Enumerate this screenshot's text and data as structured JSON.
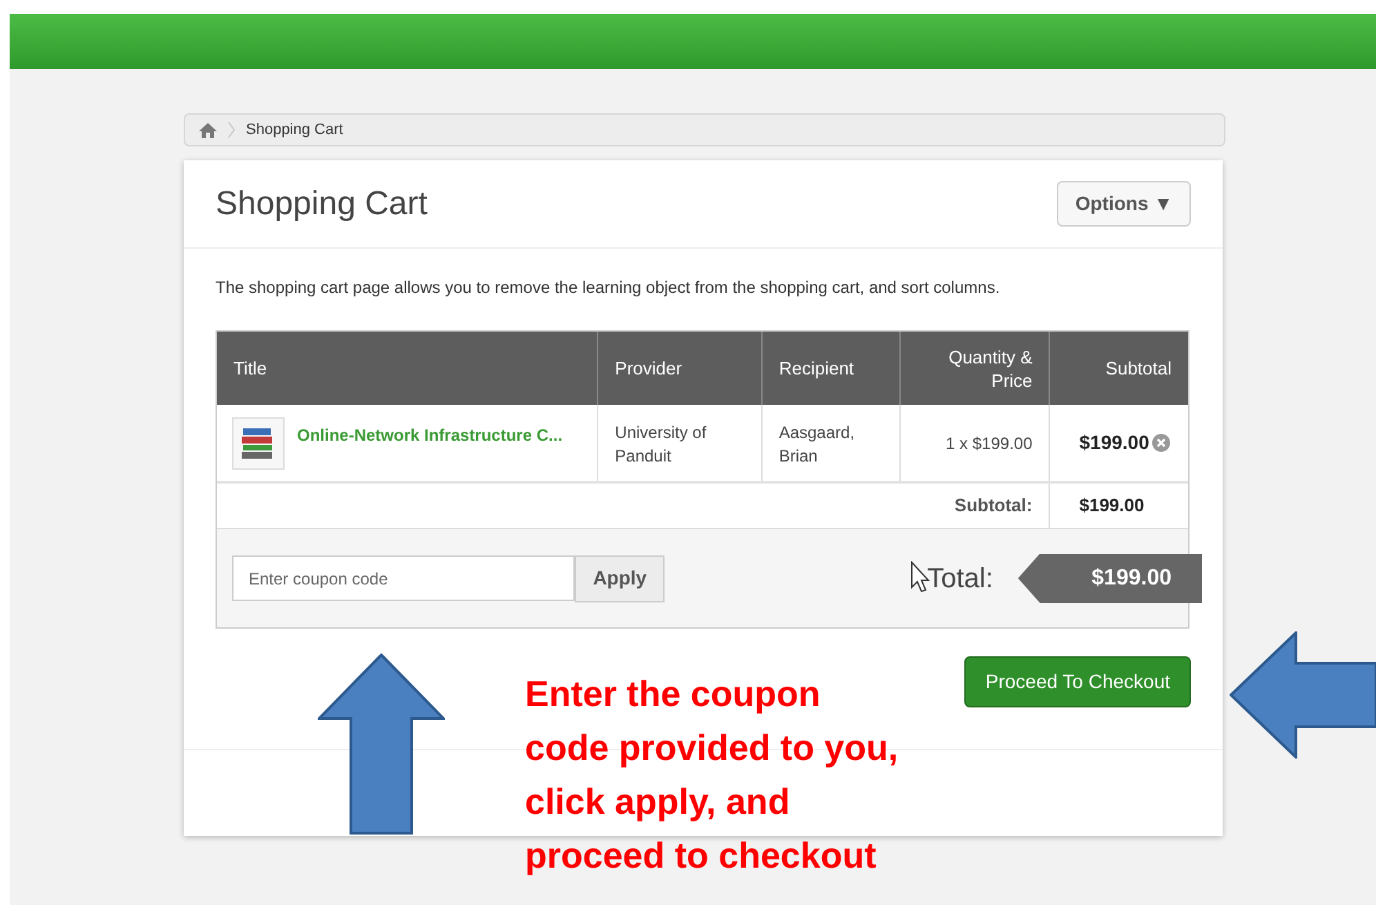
{
  "breadcrumb": {
    "items": [
      "Shopping Cart"
    ]
  },
  "page": {
    "title": "Shopping Cart",
    "options_button": "Options ▼",
    "description": "The shopping cart page allows you to remove the learning object from the shopping cart, and sort columns."
  },
  "table": {
    "columns": [
      "Title",
      "Provider",
      "Recipient",
      "Quantity & Price",
      "Subtotal"
    ],
    "rows": [
      {
        "title": "Online-Network Infrastructure C...",
        "provider": "University of Panduit",
        "recipient": "Aasgaard, Brian",
        "quantity_price": "1 x $199.00",
        "subtotal": "$199.00"
      }
    ],
    "subtotal_label": "Subtotal:",
    "subtotal_value": "$199.00"
  },
  "coupon": {
    "placeholder": "Enter coupon code",
    "apply_button": "Apply"
  },
  "total": {
    "label": "Total:",
    "value": "$199.00"
  },
  "checkout_button": "Proceed To Checkout",
  "annotation": {
    "lines": [
      "Enter the coupon",
      "code provided to you,",
      "click apply, and",
      "proceed to checkout"
    ]
  }
}
